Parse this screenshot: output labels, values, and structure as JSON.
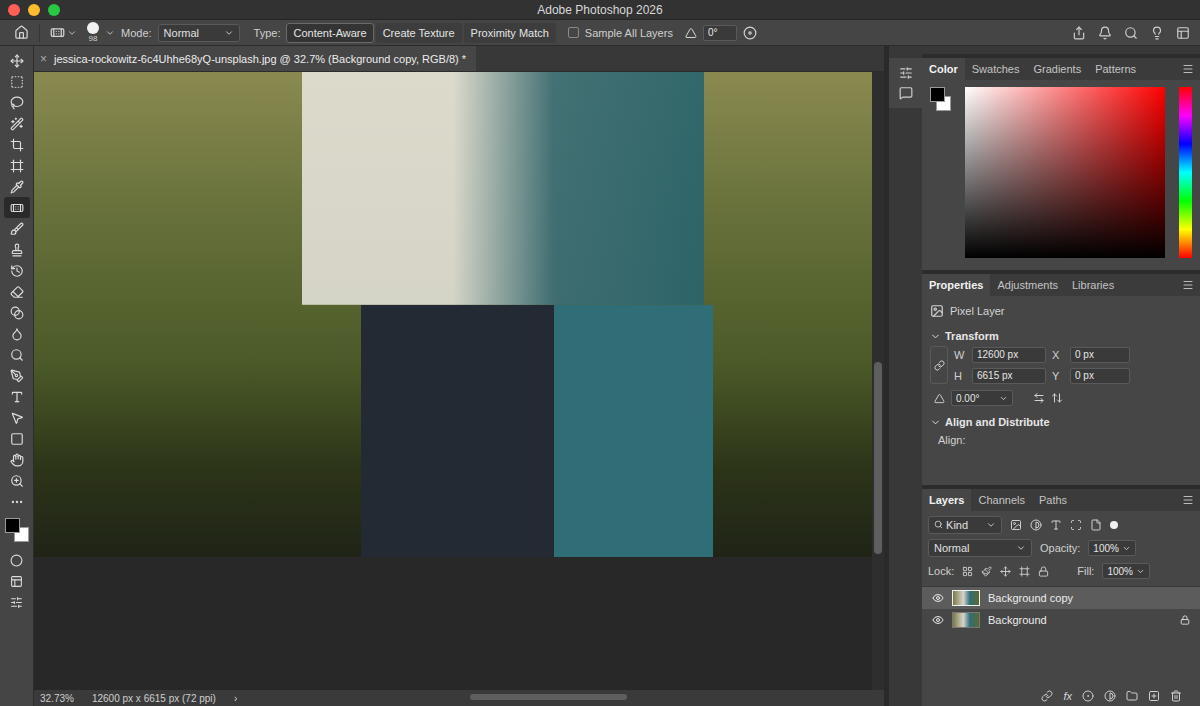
{
  "window": {
    "title": "Adobe Photoshop 2026"
  },
  "options_bar": {
    "brush_size": "98",
    "mode_label": "Mode:",
    "mode": "Normal",
    "type_label": "Type:",
    "types": [
      {
        "label": "Content-Aware",
        "selected": true
      },
      {
        "label": "Create Texture",
        "selected": false
      },
      {
        "label": "Proximity Match",
        "selected": false
      }
    ],
    "sample_all_layers": {
      "label": "Sample All Layers",
      "checked": false
    },
    "angle": "0°"
  },
  "tools": [
    {
      "selected": false
    },
    {
      "selected": false
    },
    {
      "selected": false
    },
    {
      "selected": false
    },
    {
      "selected": false
    },
    {
      "selected": false
    },
    {
      "selected": false
    },
    {
      "selected": true
    },
    {
      "selected": false
    },
    {
      "selected": false
    },
    {
      "selected": false
    },
    {
      "selected": false
    },
    {
      "selected": false
    },
    {
      "selected": false
    },
    {
      "selected": false
    },
    {
      "selected": false
    },
    {
      "selected": false
    },
    {
      "selected": false
    },
    {
      "selected": false
    },
    {
      "selected": false
    },
    {
      "selected": false
    },
    {
      "selected": false
    }
  ],
  "swatches": {
    "foreground": "#000000",
    "background": "#ffffff"
  },
  "document_tab": {
    "close": "×",
    "title": "jessica-rockowitz-6c4Uhhe68yQ-unsplash.jpg @ 32.7% (Background copy, RGB/8) *"
  },
  "scroll": {
    "vertical": {
      "offset": 0.47,
      "size": 0.31
    },
    "horizontal": {
      "offset": 0.5,
      "size": 0.27
    }
  },
  "status_bar": {
    "zoom": "32.73%",
    "info": "12600 px x 6615 px (72 ppi)",
    "arrow": "›"
  },
  "color_panel": {
    "tabs": [
      {
        "label": "Color",
        "selected": true
      },
      {
        "label": "Swatches",
        "selected": false
      },
      {
        "label": "Gradients",
        "selected": false
      },
      {
        "label": "Patterns",
        "selected": false
      }
    ],
    "foreground": "#000000",
    "background": "#ffffff"
  },
  "properties_panel": {
    "tabs": [
      {
        "label": "Properties",
        "selected": true
      },
      {
        "label": "Adjustments",
        "selected": false
      },
      {
        "label": "Libraries",
        "selected": false
      }
    ],
    "kind": "Pixel Layer",
    "transform": {
      "title": "Transform",
      "linked": true,
      "fields": [
        {
          "label": "W",
          "value": "12600 px"
        },
        {
          "label": "X",
          "value": "0 px"
        },
        {
          "label": "H",
          "value": "6615 px"
        },
        {
          "label": "Y",
          "value": "0 px"
        }
      ],
      "angle": "0.00°"
    },
    "align": {
      "title": "Align and Distribute",
      "label": "Align:"
    }
  },
  "layers_panel": {
    "tabs": [
      {
        "label": "Layers",
        "selected": true
      },
      {
        "label": "Channels",
        "selected": false
      },
      {
        "label": "Paths",
        "selected": false
      }
    ],
    "filter": "Kind",
    "filter_on": true,
    "blend_mode": "Normal",
    "opacity_label": "Opacity:",
    "opacity": "100%",
    "lock_label": "Lock:",
    "fill_label": "Fill:",
    "fill": "100%",
    "layers": [
      {
        "name": "Background copy",
        "visible": true,
        "selected": true,
        "locked": false
      },
      {
        "name": "Background",
        "visible": true,
        "selected": false,
        "locked": true
      }
    ],
    "fx": "fx"
  }
}
